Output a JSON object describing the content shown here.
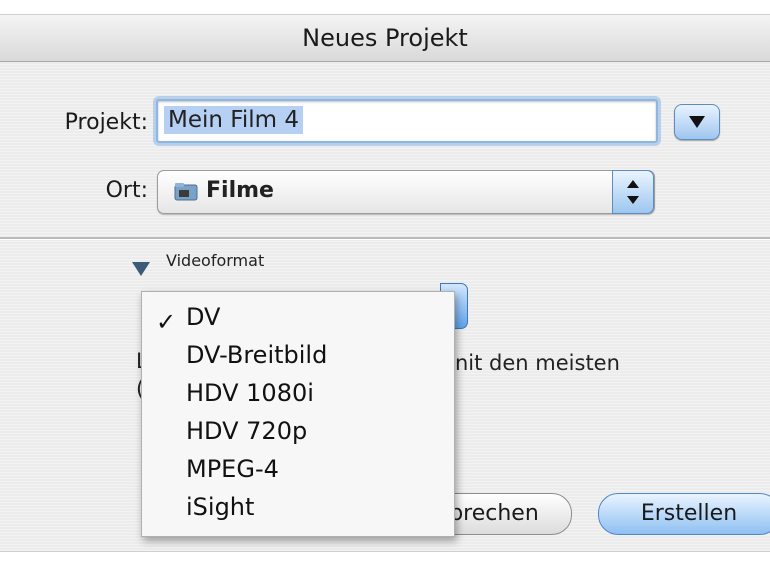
{
  "window": {
    "title": "Neues Projekt"
  },
  "form": {
    "project_label": "Projekt:",
    "project_value": "Mein Film 4",
    "location_label": "Ort:",
    "location_value": "Filme"
  },
  "video_section": {
    "label": "Videoformat",
    "description_line1_fragment": "nit den meisten"
  },
  "format_menu": {
    "selected": "DV",
    "items": [
      "DV",
      "DV-Breitbild",
      "HDV 1080i",
      "HDV 720p",
      "MPEG-4",
      "iSight"
    ]
  },
  "buttons": {
    "cancel_label": "brechen",
    "create_label": "Erstellen"
  },
  "colors": {
    "accent_blue": "#9fc6ef",
    "selection": "#b5d0f2"
  }
}
